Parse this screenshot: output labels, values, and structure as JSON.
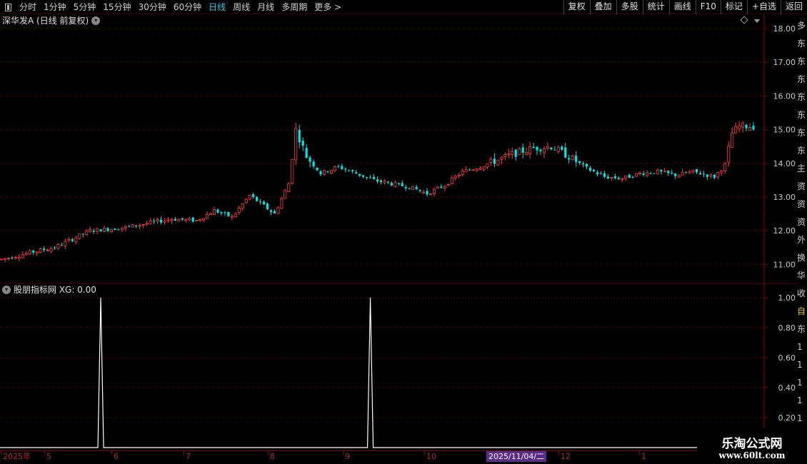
{
  "toolbar": {
    "left_items": [
      {
        "label": "分时",
        "active": false
      },
      {
        "label": "1分钟",
        "active": false
      },
      {
        "label": "5分钟",
        "active": false
      },
      {
        "label": "15分钟",
        "active": false
      },
      {
        "label": "30分钟",
        "active": false
      },
      {
        "label": "60分钟",
        "active": false
      },
      {
        "label": "日线",
        "active": true
      },
      {
        "label": "周线",
        "active": false
      },
      {
        "label": "月线",
        "active": false
      },
      {
        "label": "多周期",
        "active": false
      },
      {
        "label": "更多 >",
        "active": false
      }
    ],
    "right_buttons": [
      "复权",
      "叠加",
      "多股",
      "统计",
      "画线",
      "F10",
      "标记",
      "+自选",
      "返回"
    ]
  },
  "main_panel": {
    "title": "深华发A (日线 前复权)",
    "info_icon": "chevron-down-circle-icon"
  },
  "sub_panel": {
    "title": "股朋指标网 XG: 0.00",
    "toggle_icon": "chevron-down-circle-icon"
  },
  "side_strip": [
    "多",
    "东",
    "东",
    "东",
    "东",
    "东",
    "东",
    "东",
    "主",
    "资",
    "资",
    "资",
    "外",
    "换",
    "华",
    "收",
    "自",
    "东",
    "1",
    "1",
    "1",
    "1",
    "1",
    "1"
  ],
  "date_axis": {
    "labels": [
      "2025年",
      "5",
      "6",
      "7",
      "8",
      "9",
      "10",
      "11",
      "12",
      "1"
    ],
    "selected_date": "2025/11/04/二"
  },
  "watermark": {
    "title": "乐淘公式网",
    "url": "www.60lt.com"
  },
  "colors": {
    "up": "#ff3c3c",
    "down": "#00e5e5",
    "grid": "#8b0000",
    "indicator": "#ffffff",
    "active_tab": "#22d3ee"
  },
  "chart_data": [
    {
      "type": "candlestick",
      "title": "深华发A (日线 前复权)",
      "y_ticks": [
        "18.00",
        "17.00",
        "16.00",
        "15.00",
        "14.00",
        "13.00",
        "12.00",
        "11.00"
      ],
      "ylim": [
        10.5,
        18.1
      ],
      "n_bars": 213,
      "keypoints": [
        [
          0,
          11.15
        ],
        [
          8,
          11.35
        ],
        [
          15,
          11.5
        ],
        [
          25,
          12.0
        ],
        [
          35,
          12.1
        ],
        [
          48,
          12.35
        ],
        [
          55,
          12.3
        ],
        [
          60,
          12.6
        ],
        [
          65,
          12.4
        ],
        [
          70,
          13.05
        ],
        [
          77,
          12.5
        ],
        [
          81,
          13.4
        ],
        [
          83,
          15.0
        ],
        [
          86,
          14.2
        ],
        [
          90,
          13.7
        ],
        [
          95,
          13.9
        ],
        [
          100,
          13.7
        ],
        [
          105,
          13.5
        ],
        [
          112,
          13.35
        ],
        [
          115,
          13.3
        ],
        [
          120,
          13.1
        ],
        [
          125,
          13.35
        ],
        [
          130,
          13.75
        ],
        [
          135,
          13.9
        ],
        [
          140,
          14.1
        ],
        [
          145,
          14.3
        ],
        [
          150,
          14.45
        ],
        [
          155,
          14.5
        ],
        [
          160,
          14.2
        ],
        [
          165,
          13.85
        ],
        [
          170,
          13.6
        ],
        [
          175,
          13.55
        ],
        [
          180,
          13.7
        ],
        [
          185,
          13.75
        ],
        [
          190,
          13.65
        ],
        [
          195,
          13.75
        ],
        [
          201,
          13.6
        ],
        [
          204,
          13.95
        ],
        [
          206,
          14.9
        ],
        [
          208,
          15.1
        ]
      ],
      "y_ticks_right_note": "price axis"
    },
    {
      "type": "line",
      "series": [
        {
          "name": "XG",
          "spikes_at_bar": [
            28,
            104
          ],
          "spike_value": 1.0,
          "base_value": 0
        }
      ],
      "y_ticks": [
        "1.00",
        "0.80",
        "0.60",
        "0.40",
        "0.20"
      ],
      "ylim": [
        0,
        1.05
      ]
    }
  ]
}
